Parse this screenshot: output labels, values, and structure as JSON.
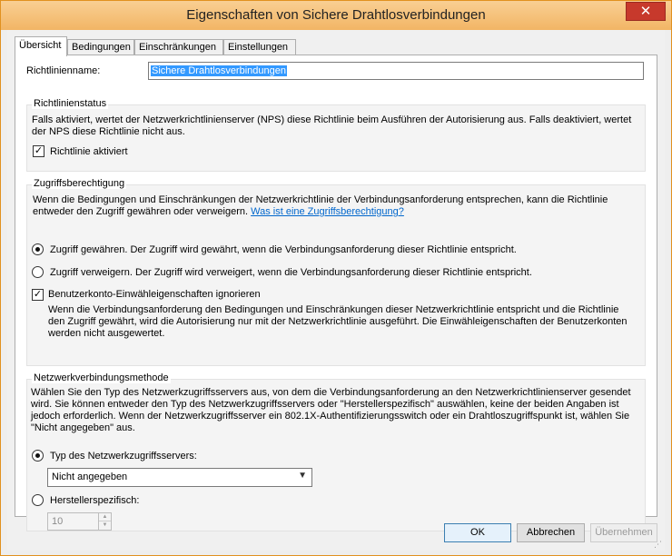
{
  "window": {
    "title": "Eigenschaften von Sichere Drahtlosverbindungen",
    "close_label": "✕"
  },
  "tabs": [
    {
      "label": "Übersicht",
      "active": true
    },
    {
      "label": "Bedingungen",
      "active": false
    },
    {
      "label": "Einschränkungen",
      "active": false
    },
    {
      "label": "Einstellungen",
      "active": false
    }
  ],
  "policy_name": {
    "label": "Richtlinienname:",
    "value": "Sichere Drahtlosverbindungen"
  },
  "status_group": {
    "title": "Richtlinienstatus",
    "description": "Falls aktiviert, wertet der Netzwerkrichtlinienserver (NPS) diese Richtlinie beim Ausführen der Autorisierung aus. Falls deaktiviert, wertet der NPS diese Richtlinie nicht aus.",
    "checkbox_label": "Richtlinie aktiviert",
    "checked": true
  },
  "access_group": {
    "title": "Zugriffsberechtigung",
    "description": "Wenn die Bedingungen und Einschränkungen der Netzwerkrichtlinie der Verbindungsanforderung entsprechen, kann die Richtlinie entweder den Zugriff gewähren oder verweigern.",
    "link": "Was ist eine Zugriffsberechtigung?",
    "grant_label": "Zugriff gewähren. Der Zugriff wird gewährt, wenn die Verbindungsanforderung dieser Richtlinie entspricht.",
    "deny_label": "Zugriff verweigern. Der Zugriff wird verweigert, wenn die Verbindungsanforderung dieser Richtlinie entspricht.",
    "grant_selected": true,
    "ignore_label": "Benutzerkonto-Einwähleigenschaften ignorieren",
    "ignore_checked": true,
    "ignore_description": "Wenn die Verbindungsanforderung den Bedingungen und Einschränkungen dieser Netzwerkrichtlinie entspricht und die Richtlinie den Zugriff gewährt, wird die Autorisierung nur mit der Netzwerkrichtlinie ausgeführt. Die Einwähleigenschaften der Benutzerkonten werden nicht ausgewertet."
  },
  "method_group": {
    "title": "Netzwerkverbindungsmethode",
    "description": "Wählen Sie den Typ des Netzwerkzugriffsservers aus, von dem die Verbindungsanforderung an den Netzwerkrichtlinienserver gesendet wird. Sie können entweder den Typ des Netzwerkzugriffsservers oder \"Herstellerspezifisch\" auswählen, keine der beiden Angaben ist jedoch erforderlich. Wenn der Netzwerkzugriffsserver ein 802.1X-Authentifizierungsswitch oder ein Drahtloszugriffspunkt ist, wählen Sie \"Nicht angegeben\" aus.",
    "type_label": "Typ des Netzwerkzugriffsservers:",
    "type_selected": true,
    "type_value": "Nicht angegeben",
    "vendor_label": "Herstellerspezifisch:",
    "vendor_value": "10"
  },
  "buttons": {
    "ok": "OK",
    "cancel": "Abbrechen",
    "apply": "Übernehmen"
  }
}
